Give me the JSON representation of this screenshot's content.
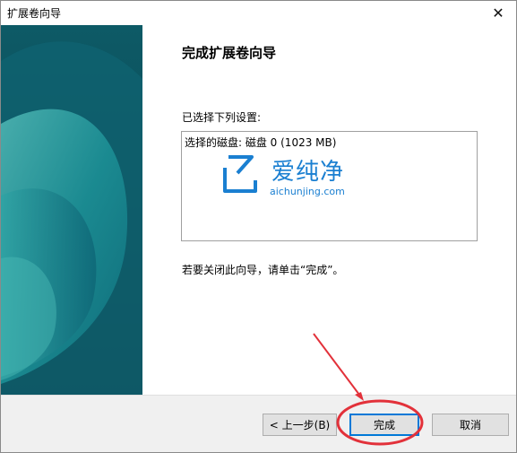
{
  "window": {
    "title": "扩展卷向导",
    "close_glyph": "✕"
  },
  "main": {
    "heading": "完成扩展卷向导",
    "settings_label": "已选择下列设置:",
    "settings_lines": [
      "选择的磁盘: 磁盘 0 (1023 MB)"
    ],
    "close_instruction": "若要关闭此向导，请单击“完成”。"
  },
  "watermark": {
    "title": "爱纯净",
    "url": "aichunjing.com"
  },
  "buttons": {
    "back": "< 上一步(B)",
    "finish": "完成",
    "cancel": "取消"
  },
  "colors": {
    "sidebar_dark": "#0b4a57",
    "sidebar_teal": "#15808a",
    "accent_blue": "#0078d7",
    "annotation_red": "#e2313a"
  }
}
